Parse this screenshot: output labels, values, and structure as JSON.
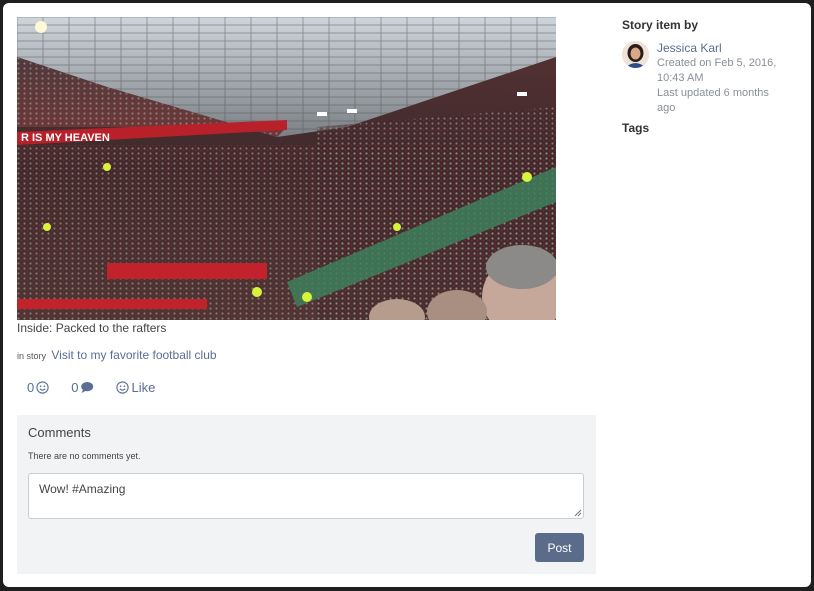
{
  "story_item": {
    "caption": "Inside: Packed to the rafters",
    "in_story_prefix": "in story",
    "story_link": "Visit to my favorite football club",
    "photo_banner_text": "R IS MY HEAVEN"
  },
  "actions": {
    "smile_count": "0",
    "comment_count": "0",
    "like_label": "Like"
  },
  "comments": {
    "title": "Comments",
    "empty_text": "There are no comments yet.",
    "input_value": "Wow! #Amazing",
    "post_label": "Post"
  },
  "sidebar": {
    "story_item_by_label": "Story item by",
    "author_name": "Jessica Karl",
    "created_text": "Created on Feb 5, 2016, 10:43 AM",
    "updated_text": "Last updated 6 months ago",
    "tags_label": "Tags"
  },
  "colors": {
    "link": "#5a6e93",
    "button": "#5b6b8a",
    "comments_bg": "#f2f3f5"
  },
  "icons": {
    "smile": "smile-icon",
    "comment": "comment-bubble-icon",
    "like": "smile-icon"
  }
}
